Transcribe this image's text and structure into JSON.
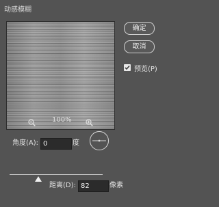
{
  "dialog": {
    "title": "动感模糊"
  },
  "buttons": {
    "ok_label": "确定",
    "cancel_label": "取消"
  },
  "preview_toggle": {
    "label": "预览(P)",
    "checked": true
  },
  "zoom": {
    "level": "100%"
  },
  "angle": {
    "label": "角度(A):",
    "value": "0",
    "unit": "度"
  },
  "distance": {
    "label": "距离(D):",
    "value": "82",
    "unit": "像素"
  },
  "colors": {
    "background": "#535353",
    "input_background": "#2b2b2b",
    "text": "#e6e6e6"
  },
  "icons": {
    "zoom_out": "zoom-out-icon",
    "zoom_in": "zoom-in-icon",
    "checkbox": "checkmark-icon"
  }
}
